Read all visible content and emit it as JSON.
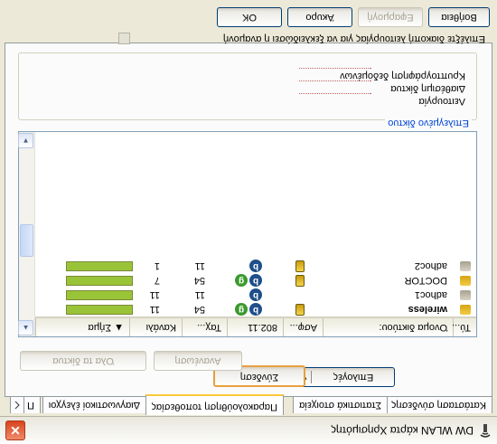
{
  "window": {
    "title": "DW WLAN κάρτα Χρησιμότης",
    "close_glyph": "✕"
  },
  "tabs": [
    {
      "label": "Κατάσταση σύνδεσης"
    },
    {
      "label": "Στατιστικά στοιχεία"
    },
    {
      "label": "Παρακολούθηση τοποθεσίας"
    },
    {
      "label": "Διαγνωστικοί έλεγχοι"
    },
    {
      "label": "Π"
    }
  ],
  "actions": {
    "connect_label": "Σύνδεση",
    "options_label": "Επιλογές",
    "options_arrow": "▼",
    "add_network_label": "Όλα τα δίκτυα",
    "refresh_label": "Ανανέωση"
  },
  "list": {
    "columns": [
      "Τύ...",
      "Όνομα δικτύου:",
      "Ασφ...",
      "802.11",
      "Ταχ...",
      "Κανάλι",
      "▲ Σήμα"
    ],
    "rows": [
      {
        "type": "infra",
        "name": "wireless",
        "bold": true,
        "secure": true,
        "b": "b",
        "g": "g",
        "speed": "54",
        "channel": "11",
        "signal": 100
      },
      {
        "type": "adhoc",
        "name": "adhoc1",
        "bold": false,
        "secure": false,
        "b": "b",
        "g": "",
        "speed": "11",
        "channel": "11",
        "signal": 100
      },
      {
        "type": "infra",
        "name": "DOCTOR",
        "bold": false,
        "secure": true,
        "b": "b",
        "g": "g",
        "speed": "54",
        "channel": "7",
        "signal": 100
      },
      {
        "type": "adhoc",
        "name": "adhoc2",
        "bold": false,
        "secure": true,
        "b": "b",
        "g": "",
        "speed": "11",
        "channel": "1",
        "signal": 100
      }
    ],
    "scroll_up": "▲",
    "scroll_down": "▼"
  },
  "selected_network": {
    "legend": "Επιλεγμένο δίκτυο",
    "labels": [
      "Λειτουργία",
      "Διαθέσιμη δίκτυα",
      "Κρυπτογράφηση δεδομένων"
    ]
  },
  "checkbox": {
    "label": "Επιλέξτε διακοπή λειτουργίας για να ξεκλειδώσει η αναμονή"
  },
  "dialog_buttons": {
    "ok": "OK",
    "cancel": "Άκυρο",
    "apply": "Εφαρμογή",
    "help": "Βοήθεια"
  }
}
